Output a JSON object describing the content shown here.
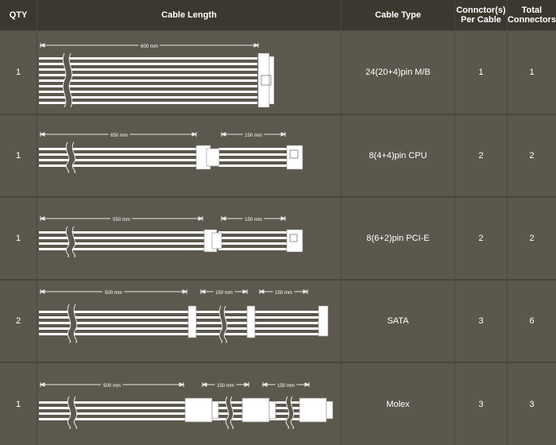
{
  "headers": {
    "qty": "QTY",
    "length": "Cable Length",
    "type": "Cable Type",
    "per_cable_line1": "Connctor(s)",
    "per_cable_line2": "Per Cable",
    "total_line1": "Total",
    "total_line2": "Connectors"
  },
  "rows": [
    {
      "qty": "1",
      "type": "24(20+4)pin M/B",
      "per_cable": "1",
      "total": "1",
      "lengths": [
        "600 mm"
      ]
    },
    {
      "qty": "1",
      "type": "8(4+4)pin CPU",
      "per_cable": "2",
      "total": "2",
      "lengths": [
        "650 mm",
        "150 mm"
      ]
    },
    {
      "qty": "1",
      "type": "8(6+2)pin PCI-E",
      "per_cable": "2",
      "total": "2",
      "lengths": [
        "550 mm",
        "150 mm"
      ]
    },
    {
      "qty": "2",
      "type": "SATA",
      "per_cable": "3",
      "total": "6",
      "lengths": [
        "500 mm",
        "150 mm",
        "150 mm"
      ]
    },
    {
      "qty": "1",
      "type": "Molex",
      "per_cable": "3",
      "total": "3",
      "lengths": [
        "500 mm",
        "150 mm",
        "150 mm"
      ]
    }
  ]
}
